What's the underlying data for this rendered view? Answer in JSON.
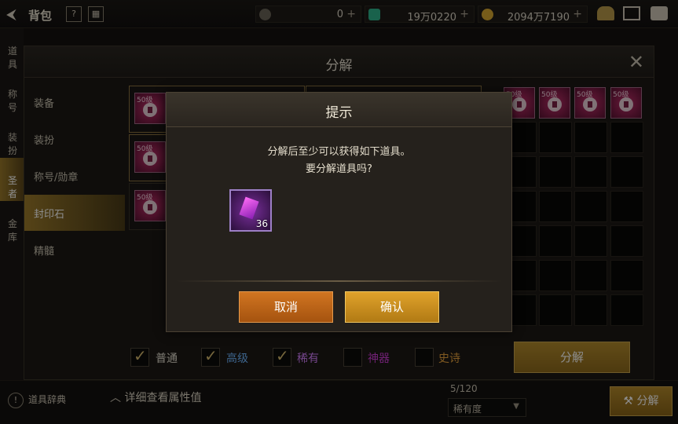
{
  "topbar": {
    "title": "背包",
    "currency1": "0",
    "currency2": "19万0220",
    "currency3": "2094万7190",
    "plus": "+",
    "colors": {
      "gold": "#d8a830",
      "green_gem": "#2fb38a"
    }
  },
  "background": {
    "side_items": [
      "道具",
      "称号",
      "装扮",
      "圣者",
      "金库"
    ],
    "dict_label": "道具辞典",
    "detail_label": "详细查看属性值",
    "count": "5/120",
    "sort_label": "稀有度",
    "decomp_label": "分解"
  },
  "window": {
    "title": "分解",
    "categories": [
      "装备",
      "装扮",
      "称号/勋章",
      "封印石",
      "精髓"
    ],
    "active_category": "封印石",
    "lock_badge": "50级",
    "filters": [
      {
        "label": "普通",
        "checked": true,
        "color": "#e6e0d2"
      },
      {
        "label": "高级",
        "checked": true,
        "color": "#6fb6ff"
      },
      {
        "label": "稀有",
        "checked": true,
        "color": "#d580ff"
      },
      {
        "label": "神器",
        "checked": false,
        "color": "#d03cd8"
      },
      {
        "label": "史诗",
        "checked": false,
        "color": "#e8a23c"
      }
    ],
    "decompose_button": "分解"
  },
  "dialog": {
    "title": "提示",
    "message_line1": "分解后至少可以获得如下道具。",
    "message_line2": "要分解道具吗?",
    "item_quantity": "36",
    "cancel": "取消",
    "confirm": "确认"
  }
}
